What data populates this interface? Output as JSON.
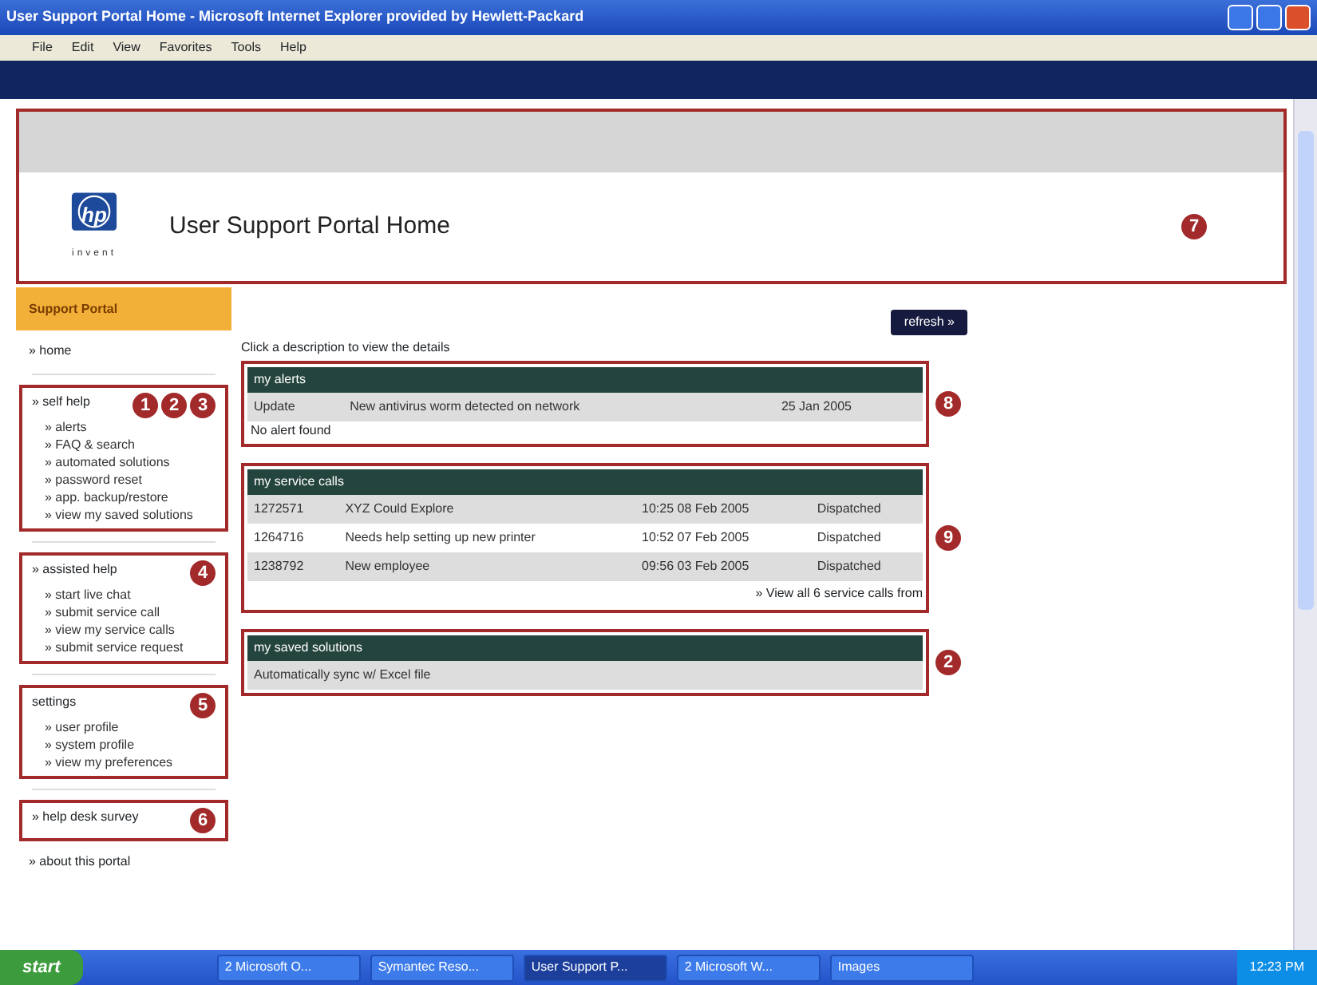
{
  "window": {
    "title": "User Support Portal Home - Microsoft Internet Explorer provided by Hewlett-Packard"
  },
  "menu": [
    "File",
    "Edit",
    "View",
    "Favorites",
    "Tools",
    "Help"
  ],
  "header": {
    "logo_text": "hp",
    "logo_sub": "invent",
    "title": "User Support Portal Home",
    "annotated": true,
    "callouts": [
      "7"
    ]
  },
  "sidebar": {
    "title": "Support Portal",
    "groups": [
      {
        "heading": "» home",
        "annotated": false
      },
      {
        "heading": "» self help",
        "items": [
          "» alerts",
          "» FAQ & search",
          "» automated solutions",
          "» password reset",
          "» app. backup/restore",
          "» view my saved solutions"
        ],
        "annotated": true,
        "callouts": [
          "1",
          "2",
          "3"
        ]
      },
      {
        "heading": "» assisted help",
        "items": [
          "» start live chat",
          "» submit service call",
          "» view my service calls",
          "» submit service request"
        ],
        "annotated": true,
        "callouts": [
          "4"
        ]
      },
      {
        "heading": "settings",
        "items": [
          "» user profile",
          "» system profile",
          "» view my preferences"
        ],
        "annotated": true,
        "callouts": [
          "5"
        ]
      },
      {
        "heading": "» help desk survey",
        "annotated": true,
        "callouts": [
          "6"
        ]
      },
      {
        "heading": "» about this portal",
        "annotated": false
      }
    ]
  },
  "main": {
    "refresh_button": "refresh »",
    "instruction": "Click a description to view the details",
    "panels": [
      {
        "title": "my alerts",
        "annotated": true,
        "callouts": [
          "8"
        ],
        "rows": [
          [
            "Update",
            "New antivirus worm detected on network",
            "25 Jan 2005"
          ]
        ],
        "note": "No alert found"
      },
      {
        "title": "my service calls",
        "annotated": true,
        "callouts": [
          "9"
        ],
        "rows": [
          [
            "1272571",
            "XYZ Could Explore",
            "10:25 08 Feb 2005",
            "Dispatched"
          ],
          [
            "1264716",
            "Needs help setting up new printer",
            "10:52 07 Feb 2005",
            "Dispatched"
          ],
          [
            "1238792",
            "New employee",
            "09:56 03 Feb 2005",
            "Dispatched"
          ]
        ],
        "footer_link": "» View all 6 service calls from"
      },
      {
        "title": "my saved solutions",
        "annotated": true,
        "callouts": [
          "2"
        ],
        "rows": [
          [
            "Automatically sync w/ Excel file"
          ]
        ]
      }
    ]
  },
  "taskbar": {
    "start": "start",
    "tasks": [
      {
        "label": "2 Microsoft O...",
        "selected": false
      },
      {
        "label": "Symantec Reso...",
        "selected": false
      },
      {
        "label": "User Support P...",
        "selected": true
      },
      {
        "label": "2 Microsoft W...",
        "selected": false
      },
      {
        "label": "Images",
        "selected": false
      }
    ],
    "clock": "12:23 PM"
  }
}
